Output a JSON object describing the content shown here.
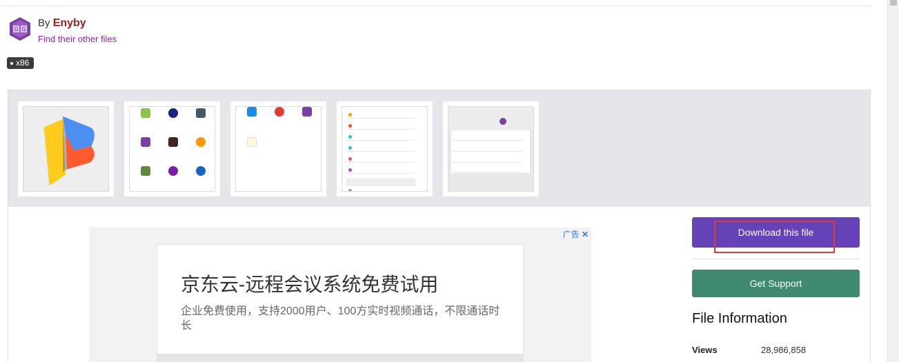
{
  "author": {
    "by_label": "By",
    "name": "Enyby",
    "other_files_link": "Find their other files"
  },
  "tags": [
    "x86"
  ],
  "gallery": {
    "thumbnails": [
      {
        "name": "app-logo"
      },
      {
        "name": "app-grid-screenshot"
      },
      {
        "name": "app-list-screenshot"
      },
      {
        "name": "menu-screenshot"
      },
      {
        "name": "settings-screenshot"
      }
    ]
  },
  "ad": {
    "label": "广告",
    "title": "京东云-远程会议系统免费试用",
    "description": "企业免费使用，支持2000用户、100方实时视频通话，不限通话时长"
  },
  "sidebar": {
    "download_label": "Download this file",
    "support_label": "Get Support",
    "file_info_title": "File Information",
    "stats": [
      {
        "label": "Views",
        "value": "28,986,858"
      }
    ]
  },
  "colors": {
    "download_button": "#6542b8",
    "support_button": "#3f8a6e",
    "author_name": "#9b1c1c",
    "link": "#8e24aa",
    "highlight": "#e53935"
  }
}
